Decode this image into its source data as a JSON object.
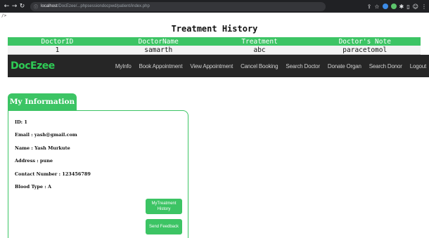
{
  "browser": {
    "url_host": "localhost",
    "url_path": "/DocEzee/...phpsessiondocpwd/patient/index.php"
  },
  "stray_text": "/>",
  "treatment_history": {
    "title": "Treatment History",
    "columns": [
      "DoctorID",
      "DoctorName",
      "Treatment",
      "Doctor's Note"
    ],
    "rows": [
      [
        "1",
        "samarth",
        "abc",
        "paracetomol"
      ]
    ]
  },
  "navbar": {
    "logo": "DocEzee",
    "links": [
      "MyInfo",
      "Book Appointment",
      "View Appointment",
      "Cancel Booking",
      "Search Doctor",
      "Donate Organ",
      "Search Donor",
      "Logout"
    ]
  },
  "my_information": {
    "title": "My Information",
    "fields": [
      "ID: 1",
      "Email : yash@gmail.com",
      "Name : Yash Murkute",
      "Address : pune",
      "Contact Number : 123456789",
      "Blood Type : A"
    ],
    "buttons": {
      "treatment_history": "MyTreatment History",
      "send_feedback": "Send Feedback"
    }
  },
  "colors": {
    "accent_green": "#3cc464",
    "navbar_bg": "#262626",
    "logo_green": "#2ecc55"
  }
}
